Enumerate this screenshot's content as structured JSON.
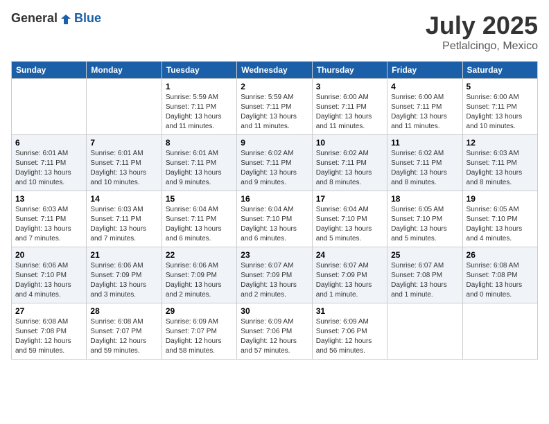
{
  "header": {
    "logo_general": "General",
    "logo_blue": "Blue",
    "month": "July 2025",
    "location": "Petlalcingo, Mexico"
  },
  "weekdays": [
    "Sunday",
    "Monday",
    "Tuesday",
    "Wednesday",
    "Thursday",
    "Friday",
    "Saturday"
  ],
  "weeks": [
    [
      {
        "day": "",
        "info": ""
      },
      {
        "day": "",
        "info": ""
      },
      {
        "day": "1",
        "info": "Sunrise: 5:59 AM\nSunset: 7:11 PM\nDaylight: 13 hours and 11 minutes."
      },
      {
        "day": "2",
        "info": "Sunrise: 5:59 AM\nSunset: 7:11 PM\nDaylight: 13 hours and 11 minutes."
      },
      {
        "day": "3",
        "info": "Sunrise: 6:00 AM\nSunset: 7:11 PM\nDaylight: 13 hours and 11 minutes."
      },
      {
        "day": "4",
        "info": "Sunrise: 6:00 AM\nSunset: 7:11 PM\nDaylight: 13 hours and 11 minutes."
      },
      {
        "day": "5",
        "info": "Sunrise: 6:00 AM\nSunset: 7:11 PM\nDaylight: 13 hours and 10 minutes."
      }
    ],
    [
      {
        "day": "6",
        "info": "Sunrise: 6:01 AM\nSunset: 7:11 PM\nDaylight: 13 hours and 10 minutes."
      },
      {
        "day": "7",
        "info": "Sunrise: 6:01 AM\nSunset: 7:11 PM\nDaylight: 13 hours and 10 minutes."
      },
      {
        "day": "8",
        "info": "Sunrise: 6:01 AM\nSunset: 7:11 PM\nDaylight: 13 hours and 9 minutes."
      },
      {
        "day": "9",
        "info": "Sunrise: 6:02 AM\nSunset: 7:11 PM\nDaylight: 13 hours and 9 minutes."
      },
      {
        "day": "10",
        "info": "Sunrise: 6:02 AM\nSunset: 7:11 PM\nDaylight: 13 hours and 8 minutes."
      },
      {
        "day": "11",
        "info": "Sunrise: 6:02 AM\nSunset: 7:11 PM\nDaylight: 13 hours and 8 minutes."
      },
      {
        "day": "12",
        "info": "Sunrise: 6:03 AM\nSunset: 7:11 PM\nDaylight: 13 hours and 8 minutes."
      }
    ],
    [
      {
        "day": "13",
        "info": "Sunrise: 6:03 AM\nSunset: 7:11 PM\nDaylight: 13 hours and 7 minutes."
      },
      {
        "day": "14",
        "info": "Sunrise: 6:03 AM\nSunset: 7:11 PM\nDaylight: 13 hours and 7 minutes."
      },
      {
        "day": "15",
        "info": "Sunrise: 6:04 AM\nSunset: 7:11 PM\nDaylight: 13 hours and 6 minutes."
      },
      {
        "day": "16",
        "info": "Sunrise: 6:04 AM\nSunset: 7:10 PM\nDaylight: 13 hours and 6 minutes."
      },
      {
        "day": "17",
        "info": "Sunrise: 6:04 AM\nSunset: 7:10 PM\nDaylight: 13 hours and 5 minutes."
      },
      {
        "day": "18",
        "info": "Sunrise: 6:05 AM\nSunset: 7:10 PM\nDaylight: 13 hours and 5 minutes."
      },
      {
        "day": "19",
        "info": "Sunrise: 6:05 AM\nSunset: 7:10 PM\nDaylight: 13 hours and 4 minutes."
      }
    ],
    [
      {
        "day": "20",
        "info": "Sunrise: 6:06 AM\nSunset: 7:10 PM\nDaylight: 13 hours and 4 minutes."
      },
      {
        "day": "21",
        "info": "Sunrise: 6:06 AM\nSunset: 7:09 PM\nDaylight: 13 hours and 3 minutes."
      },
      {
        "day": "22",
        "info": "Sunrise: 6:06 AM\nSunset: 7:09 PM\nDaylight: 13 hours and 2 minutes."
      },
      {
        "day": "23",
        "info": "Sunrise: 6:07 AM\nSunset: 7:09 PM\nDaylight: 13 hours and 2 minutes."
      },
      {
        "day": "24",
        "info": "Sunrise: 6:07 AM\nSunset: 7:09 PM\nDaylight: 13 hours and 1 minute."
      },
      {
        "day": "25",
        "info": "Sunrise: 6:07 AM\nSunset: 7:08 PM\nDaylight: 13 hours and 1 minute."
      },
      {
        "day": "26",
        "info": "Sunrise: 6:08 AM\nSunset: 7:08 PM\nDaylight: 13 hours and 0 minutes."
      }
    ],
    [
      {
        "day": "27",
        "info": "Sunrise: 6:08 AM\nSunset: 7:08 PM\nDaylight: 12 hours and 59 minutes."
      },
      {
        "day": "28",
        "info": "Sunrise: 6:08 AM\nSunset: 7:07 PM\nDaylight: 12 hours and 59 minutes."
      },
      {
        "day": "29",
        "info": "Sunrise: 6:09 AM\nSunset: 7:07 PM\nDaylight: 12 hours and 58 minutes."
      },
      {
        "day": "30",
        "info": "Sunrise: 6:09 AM\nSunset: 7:06 PM\nDaylight: 12 hours and 57 minutes."
      },
      {
        "day": "31",
        "info": "Sunrise: 6:09 AM\nSunset: 7:06 PM\nDaylight: 12 hours and 56 minutes."
      },
      {
        "day": "",
        "info": ""
      },
      {
        "day": "",
        "info": ""
      }
    ]
  ]
}
